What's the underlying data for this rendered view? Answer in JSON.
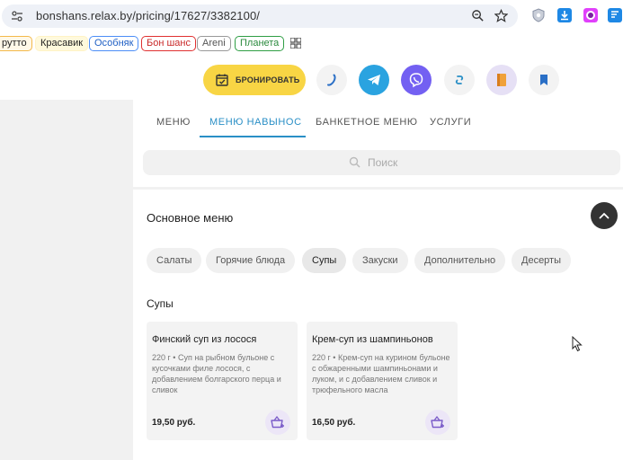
{
  "browser": {
    "url": "bonshans.relax.by/pricing/17627/3382100/",
    "zoom_icon": "zoom-icon",
    "star_icon": "bookmark-star-icon"
  },
  "bookmarks": [
    {
      "label": "рутто",
      "color": "#d29922"
    },
    {
      "label": "Красавик",
      "color": "#f0d44a"
    },
    {
      "label": "Особняк",
      "color": "#3b82f6"
    },
    {
      "label": "Бон шанс",
      "color": "#e03131"
    },
    {
      "label": "Areni",
      "color": "#999999"
    },
    {
      "label": "Планета",
      "color": "#2f9e44"
    }
  ],
  "actions": {
    "book_label": "БРОНИРОВАТЬ",
    "accent": "#f8d544"
  },
  "tabs": [
    {
      "label": "МЕНЮ",
      "active": false
    },
    {
      "label": "МЕНЮ НАВЫНОС",
      "active": true
    },
    {
      "label": "БАНКЕТНОЕ МЕНЮ",
      "active": false
    },
    {
      "label": "УСЛУГИ",
      "active": false
    }
  ],
  "search": {
    "placeholder": "Поиск"
  },
  "menu": {
    "section_title": "Основное меню",
    "categories": [
      {
        "label": "Салаты",
        "active": false
      },
      {
        "label": "Горячие блюда",
        "active": false
      },
      {
        "label": "Супы",
        "active": true
      },
      {
        "label": "Закуски",
        "active": false
      },
      {
        "label": "Дополнительно",
        "active": false
      },
      {
        "label": "Десерты",
        "active": false
      }
    ],
    "subsection_title": "Супы",
    "items": [
      {
        "name": "Финский суп из лосося",
        "description": "220 г • Суп на рыбном бульоне с кусочками филе лосося, с добавлением болгарского перца и сливок",
        "price": "19,50 руб."
      },
      {
        "name": "Крем-суп из шампиньонов",
        "description": "220 г • Крем-суп на курином бульоне с обжаренными шампиньонами и луком, и с добавлением сливок и трюфельного масла",
        "price": "16,50 руб."
      }
    ]
  },
  "colors": {
    "tab_active": "#2a8fc6",
    "telegram": "#2aa3e0",
    "viber": "#7360f2",
    "cart_bg": "#ece6f7"
  }
}
